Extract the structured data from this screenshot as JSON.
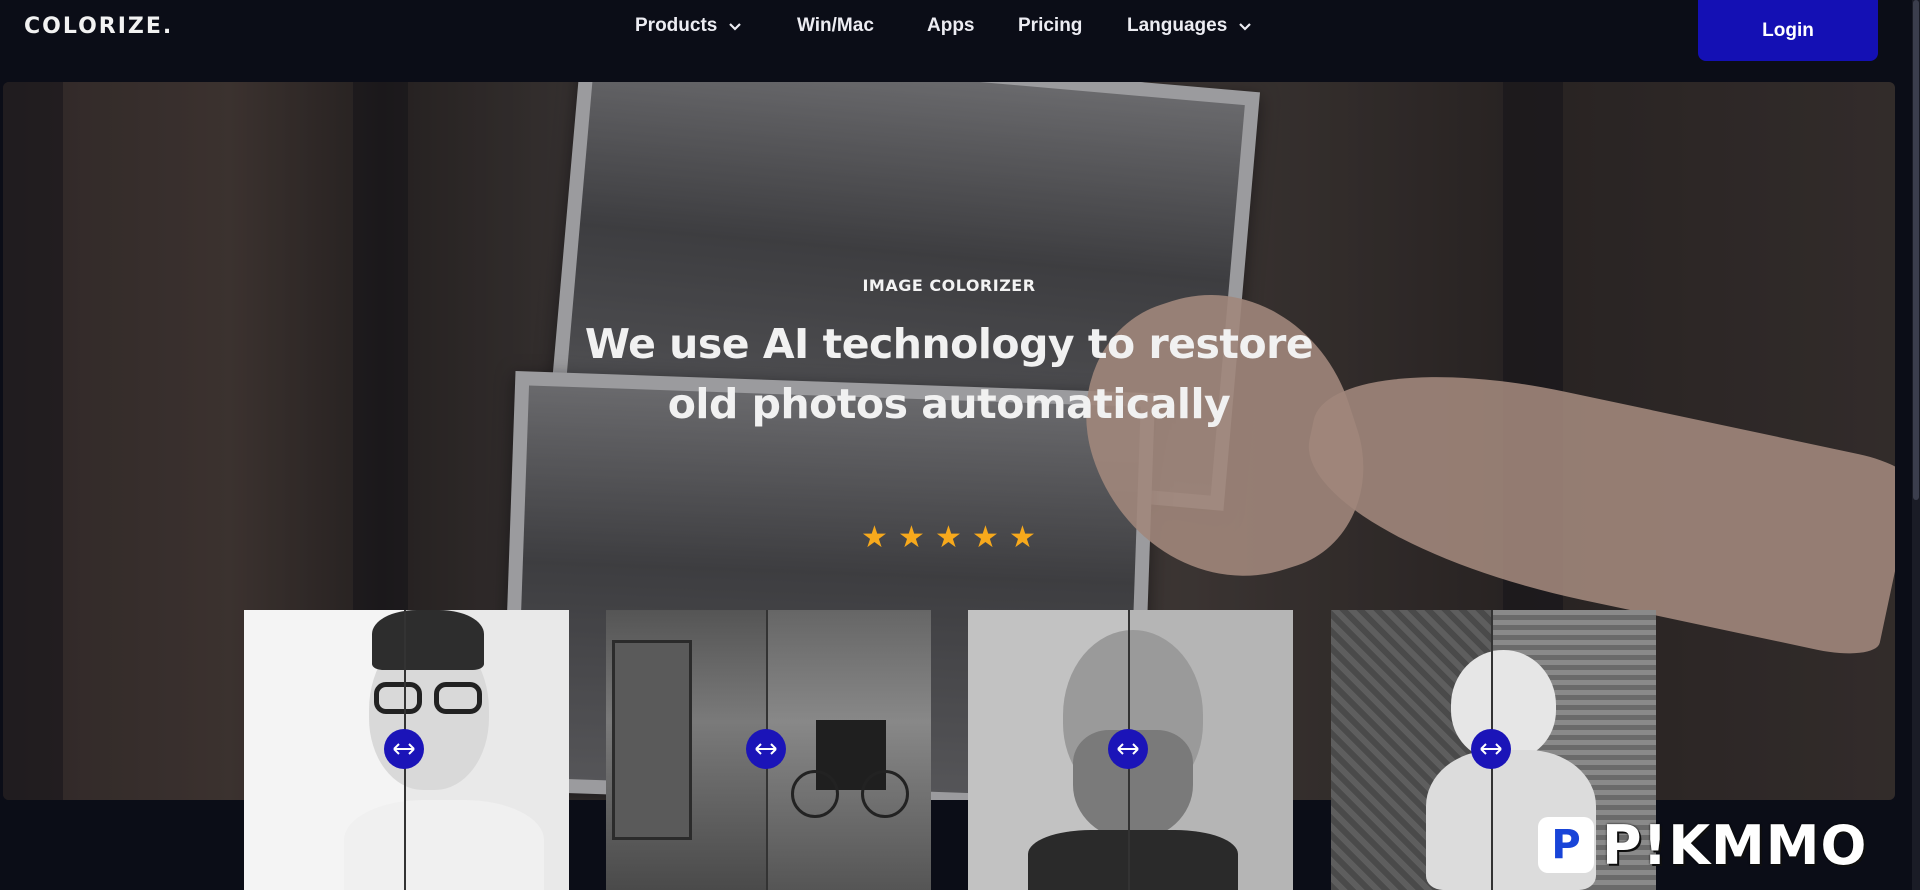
{
  "brand": {
    "logo_text": "COLORIZE."
  },
  "nav": {
    "items": [
      {
        "label": "Products",
        "has_dropdown": true
      },
      {
        "label": "Win/Mac",
        "has_dropdown": false
      },
      {
        "label": "Apps",
        "has_dropdown": false
      },
      {
        "label": "Pricing",
        "has_dropdown": false
      },
      {
        "label": "Languages",
        "has_dropdown": true
      }
    ],
    "login_label": "Login"
  },
  "hero": {
    "eyebrow": "IMAGE COLORIZER",
    "headline": "We use AI technology to restore old photos automatically",
    "rating_stars": 5
  },
  "comparisons": [
    {
      "subject": "man with glasses portrait"
    },
    {
      "subject": "graffiti wall with bicycle"
    },
    {
      "subject": "bearded old man portrait"
    },
    {
      "subject": "baby in chair"
    }
  ],
  "compare_handle_icon": "left-right-arrow",
  "watermark": {
    "logo_letter": "P",
    "text": "P!KMMO"
  },
  "colors": {
    "background": "#0b0d17",
    "login_button": "#1410b4",
    "handle": "#1b14b8",
    "star": "#f7a91c"
  }
}
